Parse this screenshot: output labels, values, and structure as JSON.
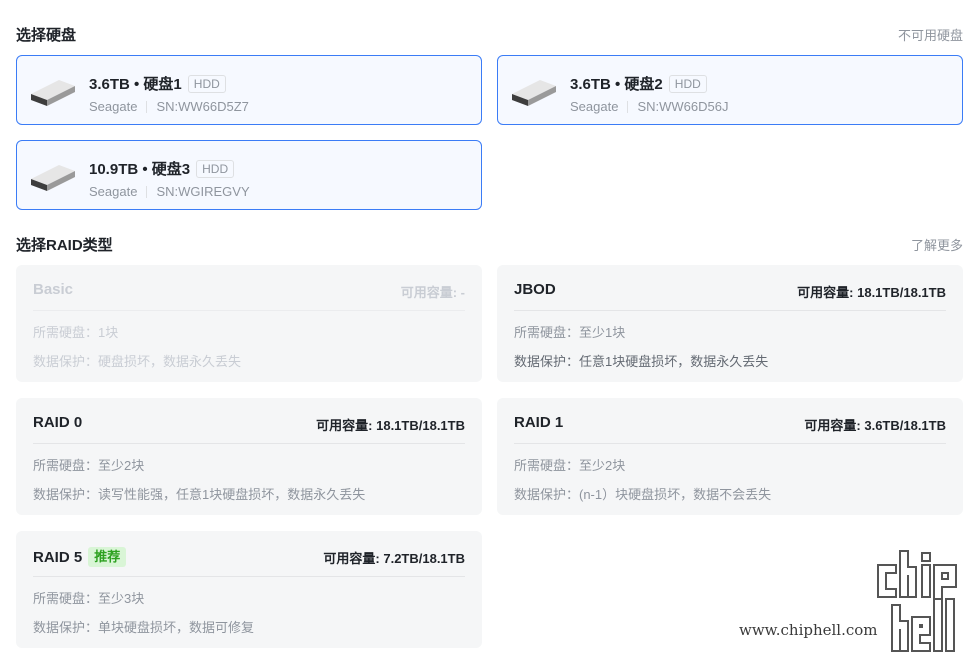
{
  "disk_section": {
    "title": "选择硬盘",
    "link": "不可用硬盘"
  },
  "disks": [
    {
      "capacity": "3.6TB • 硬盘1",
      "type": "HDD",
      "brand": "Seagate",
      "serial": "SN:WW66D5Z7"
    },
    {
      "capacity": "3.6TB • 硬盘2",
      "type": "HDD",
      "brand": "Seagate",
      "serial": "SN:WW66D56J"
    },
    {
      "capacity": "10.9TB • 硬盘3",
      "type": "HDD",
      "brand": "Seagate",
      "serial": "SN:WGIREGVY"
    }
  ],
  "raid_section": {
    "title": "选择RAID类型",
    "link": "了解更多"
  },
  "raid_types": [
    {
      "name": "Basic",
      "capacity": "可用容量: -",
      "disks": "所需硬盘：1块",
      "protection": "数据保护：硬盘损坏，数据永久丢失",
      "state": "disabled"
    },
    {
      "name": "JBOD",
      "capacity": "可用容量: 18.1TB/18.1TB",
      "disks": "所需硬盘：至少1块",
      "protection": "数据保护：任意1块硬盘损坏，数据永久丢失",
      "state": "active"
    },
    {
      "name": "RAID 0",
      "capacity": "可用容量: 18.1TB/18.1TB",
      "disks": "所需硬盘：至少2块",
      "protection": "数据保护：读写性能强，任意1块硬盘损坏，数据永久丢失",
      "state": "normal"
    },
    {
      "name": "RAID 1",
      "capacity": "可用容量: 3.6TB/18.1TB",
      "disks": "所需硬盘：至少2块",
      "protection": "数据保护：(n-1）块硬盘损坏，数据不会丢失",
      "state": "normal"
    },
    {
      "name": "RAID 5",
      "badge": "推荐",
      "capacity": "可用容量: 7.2TB/18.1TB",
      "disks": "所需硬盘：至少3块",
      "protection": "数据保护：单块硬盘损坏，数据可修复",
      "state": "normal"
    }
  ],
  "watermark": {
    "text": "www.chiphell.com",
    "logo": "chip hell"
  },
  "colors": {
    "accent": "#3b7cf6",
    "recommend": "#2ea121",
    "muted": "#8f959e"
  }
}
